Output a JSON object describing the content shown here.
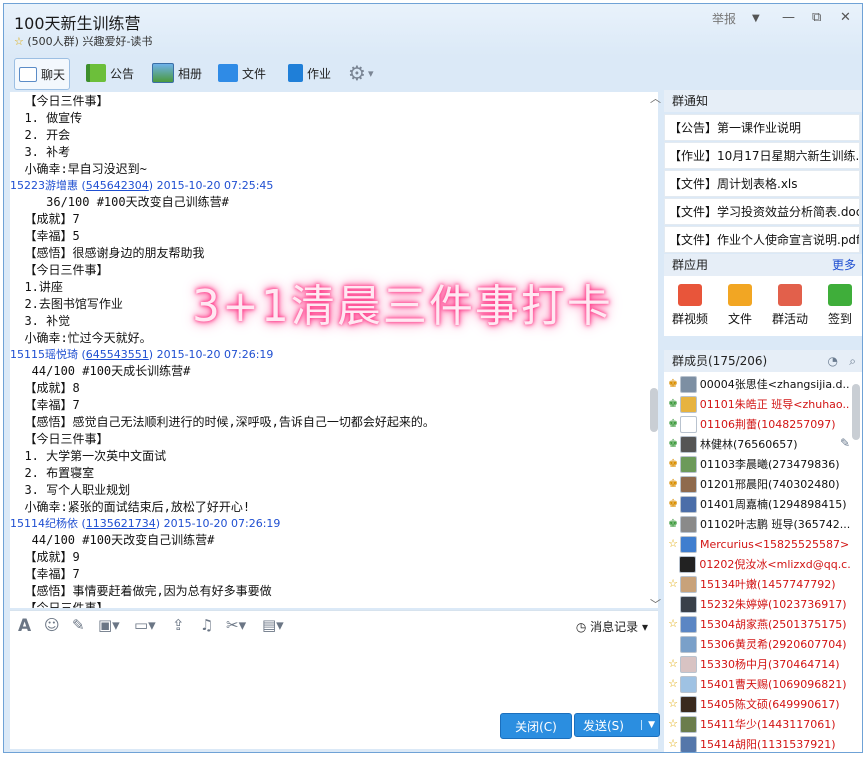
{
  "window": {
    "title": "100天新生训练营",
    "subtitle_star": "☆",
    "subtitle": "(500人群) 兴趣爱好-读书",
    "report_label": "举报",
    "ctrl_dropdown": "▼",
    "ctrl_min": "—",
    "ctrl_max": "⧉",
    "ctrl_close": "✕"
  },
  "toolbar": {
    "chat_label": "聊天",
    "notice_label": "公告",
    "album_label": "相册",
    "file_label": "文件",
    "homework_label": "作业",
    "settings_dropdown": "▾"
  },
  "chat": {
    "lines": [
      {
        "text": "  【今日三件事】"
      },
      {
        "text": "  1. 做宣传"
      },
      {
        "text": "  2. 开会"
      },
      {
        "text": "  3. 补考"
      },
      {
        "text": "  小确幸:早自习没迟到~"
      },
      {
        "header": true,
        "name": "15223游增惠",
        "qq": "545642304",
        "time": "2015-10-20 07:25:45"
      },
      {
        "text": "     36/100 #100天改变自己训练营#"
      },
      {
        "text": "  【成就】7"
      },
      {
        "text": "  【幸福】5"
      },
      {
        "text": "  【感悟】很感谢身边的朋友帮助我"
      },
      {
        "text": "  【今日三件事】"
      },
      {
        "text": "  1.讲座"
      },
      {
        "text": "  2.去图书馆写作业"
      },
      {
        "text": "  3. 补觉"
      },
      {
        "text": "  小确幸:忙过今天就好。"
      },
      {
        "header": true,
        "name": "15115瑶悦琦",
        "qq": "645543551",
        "time": "2015-10-20 07:26:19"
      },
      {
        "text": "   44/100 #100天成长训练营#"
      },
      {
        "text": "  【成就】8"
      },
      {
        "text": "  【幸福】7"
      },
      {
        "text": "  【感悟】感觉自己无法顺利进行的时候,深呼吸,告诉自己一切都会好起来的。"
      },
      {
        "text": "  【今日三件事】"
      },
      {
        "text": "  1. 大学第一次英中文面试"
      },
      {
        "text": "  2. 布置寝室"
      },
      {
        "text": "  3. 写个人职业规划"
      },
      {
        "text": "  小确幸:紧张的面试结束后,放松了好开心!"
      },
      {
        "header": true,
        "name": "15114纪杨依",
        "qq": "1135621734",
        "time": "2015-10-20 07:26:19"
      },
      {
        "text": "   44/100 #100天改变自己训练营#"
      },
      {
        "text": "  【成就】9"
      },
      {
        "text": "  【幸福】7"
      },
      {
        "text": "  【感悟】事情要赶着做完,因为总有好多事要做"
      },
      {
        "text": "  【今日三件事】"
      }
    ]
  },
  "overlay_text": "3+1清晨三件事打卡",
  "input": {
    "history_label": "消息记录",
    "history_dropdown": "▾",
    "close_label": "关闭(C)",
    "send_label": "发送(S)",
    "send_dropdown": "▼"
  },
  "notices": {
    "title": "群通知",
    "items": [
      "【公告】第一课作业说明",
      "【作业】10月17日星期六新生训练...",
      "【文件】周计划表格.xls",
      "【文件】学习投资效益分析简表.doc",
      "【文件】作业个人使命宣言说明.pdf"
    ]
  },
  "apps": {
    "title": "群应用",
    "more": "更多",
    "items": [
      {
        "label": "群视频",
        "color": "#e8553a"
      },
      {
        "label": "文件",
        "color": "#f2a623"
      },
      {
        "label": "群活动",
        "color": "#e2604b"
      },
      {
        "label": "签到",
        "color": "#3fae3a"
      }
    ]
  },
  "members": {
    "title": "群成员(175/206)",
    "items": [
      {
        "name": "00004张思佳<zhangsijia.d...",
        "color": "#111111",
        "badge": "♚",
        "badge_color": "#d98e00",
        "avatar": "#7d8fa3"
      },
      {
        "name": "01101朱皓正 班导<zhuhao...",
        "color": "#d21414",
        "badge": "♚",
        "badge_color": "#3e9b3e",
        "avatar": "#e7b33f"
      },
      {
        "name": "01106荆蕾(1048257097)",
        "color": "#d21414",
        "badge": "♚",
        "badge_color": "#3e9b3e",
        "avatar": "#ffffff"
      },
      {
        "name": "林健林(76560657)",
        "color": "#111111",
        "badge": "♚",
        "badge_color": "#3e9b3e",
        "avatar": "#555555"
      },
      {
        "name": "01103李晨曦(273479836)",
        "color": "#111111",
        "badge": "♚",
        "badge_color": "#d98e00",
        "avatar": "#6c9a5a"
      },
      {
        "name": "01201邢晨阳(740302480)",
        "color": "#111111",
        "badge": "♚",
        "badge_color": "#d98e00",
        "avatar": "#8f6a4d"
      },
      {
        "name": "01401周嘉楠(1294898415)",
        "color": "#111111",
        "badge": "♚",
        "badge_color": "#d98e00",
        "avatar": "#4b6ea9"
      },
      {
        "name": "01102叶志鹏 班导(365742...",
        "color": "#111111",
        "badge": "♚",
        "badge_color": "#3e9b3e",
        "avatar": "#8a8a8a"
      },
      {
        "name": "Mercurius<15825525587>",
        "color": "#d21414",
        "badge": "☆",
        "badge_color": "#e0a800",
        "avatar": "#3f7ecf"
      },
      {
        "name": "01202倪汝冰<mlizxd@qq.c...",
        "color": "#d21414",
        "badge": "",
        "badge_color": "#e0a800",
        "avatar": "#222222"
      },
      {
        "name": "15134叶嫩(1457747792)",
        "color": "#d21414",
        "badge": "☆",
        "badge_color": "#e0a800",
        "avatar": "#c8a27a"
      },
      {
        "name": "15232朱婷婷(1023736917)",
        "color": "#d21414",
        "badge": "",
        "badge_color": "#e0a800",
        "avatar": "#39404a"
      },
      {
        "name": "15304胡家燕(2501375175)",
        "color": "#d21414",
        "badge": "☆",
        "badge_color": "#e0a800",
        "avatar": "#5b86c4"
      },
      {
        "name": "15306黄灵希(2920607704)",
        "color": "#d21414",
        "badge": "",
        "badge_color": "#e0a800",
        "avatar": "#7aa0c9"
      },
      {
        "name": "15330杨中月(370464714)",
        "color": "#d21414",
        "badge": "☆",
        "badge_color": "#e0a800",
        "avatar": "#d8c3c3"
      },
      {
        "name": "15401曹天赐(1069096821)",
        "color": "#d21414",
        "badge": "☆",
        "badge_color": "#e0a800",
        "avatar": "#9fc2e3"
      },
      {
        "name": "15405陈文硕(649990617)",
        "color": "#d21414",
        "badge": "☆",
        "badge_color": "#e0a800",
        "avatar": "#3a2a1e"
      },
      {
        "name": "15411华少(1443117061)",
        "color": "#d21414",
        "badge": "☆",
        "badge_color": "#e0a800",
        "avatar": "#6b7d4c"
      },
      {
        "name": "15414胡阳(1131537921)",
        "color": "#d21414",
        "badge": "☆",
        "badge_color": "#e0a800",
        "avatar": "#5577aa"
      }
    ]
  }
}
